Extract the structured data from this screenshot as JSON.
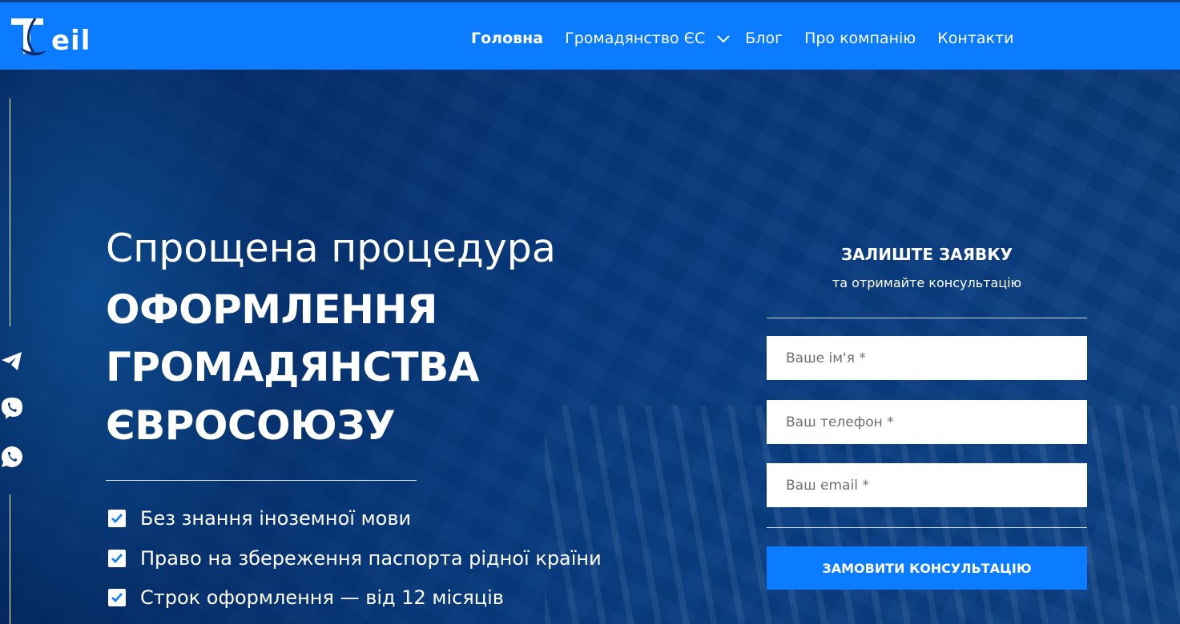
{
  "header": {
    "logo_text": "eil",
    "logo_icon": "teil-logo-icon",
    "nav": [
      {
        "label": "Головна",
        "active": true
      },
      {
        "label": "Громадянство ЄС",
        "has_dropdown": true
      },
      {
        "label": "Блог"
      },
      {
        "label": "Про компанію"
      },
      {
        "label": "Контакти"
      }
    ]
  },
  "social": [
    {
      "icon": "telegram-icon"
    },
    {
      "icon": "viber-icon"
    },
    {
      "icon": "whatsapp-icon"
    }
  ],
  "hero": {
    "title_light": "Спрощена процедура",
    "title_bold": [
      "ОФОРМЛЕННЯ",
      "ГРОМАДЯНСТВА",
      "ЄВРОСОЮЗУ"
    ],
    "features": [
      "Без знання іноземної мови",
      "Право на збереження паспорта рідної країни",
      "Строк оформлення — від 12 місяців"
    ]
  },
  "form": {
    "title": "ЗАЛИШТЕ ЗАЯВКУ",
    "subtitle": "та отримайте консультацію",
    "name_placeholder": "Ваше ім'я *",
    "phone_placeholder": "Ваш телефон *",
    "email_placeholder": "Ваш email *",
    "submit_label": "ЗАМОВИТИ КОНСУЛЬТАЦІЮ"
  },
  "colors": {
    "brand_blue": "#0b7bff",
    "white": "#ffffff"
  }
}
